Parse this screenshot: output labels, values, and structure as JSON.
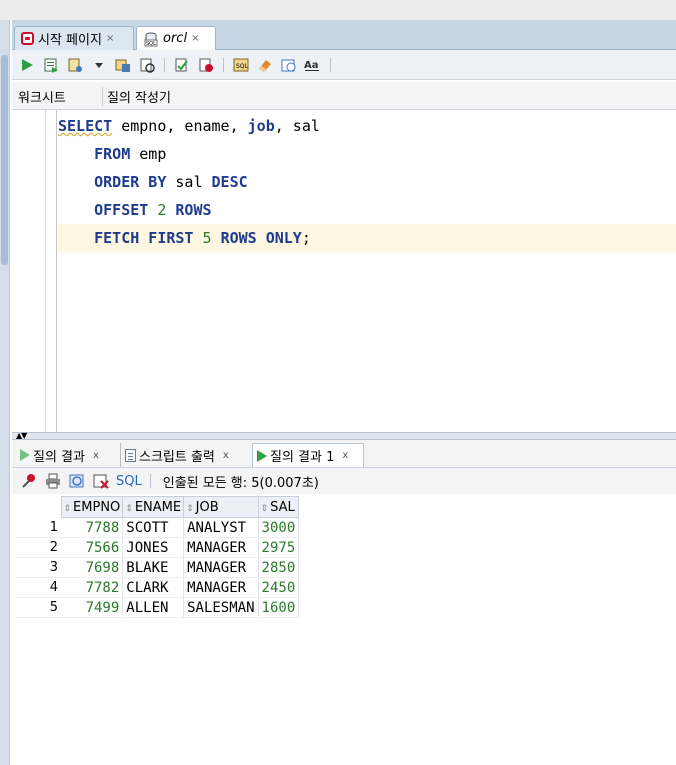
{
  "doc_tabs": [
    {
      "label": "시작 페이지",
      "close": "×"
    },
    {
      "label": "orcl",
      "close": "×"
    }
  ],
  "editor_tabs": [
    "워크시트",
    "질의 작성기"
  ],
  "code_lines": [
    {
      "parts": [
        [
          "kw",
          "SELECT"
        ],
        [
          "t",
          " empno, ename, "
        ],
        [
          "kw",
          "job"
        ],
        [
          "t",
          ", sal"
        ]
      ]
    },
    {
      "parts": [
        [
          "t",
          "    "
        ],
        [
          "kw",
          "FROM"
        ],
        [
          "t",
          " emp"
        ]
      ]
    },
    {
      "parts": [
        [
          "t",
          "    "
        ],
        [
          "kw",
          "ORDER BY"
        ],
        [
          "t",
          " sal "
        ],
        [
          "kw",
          "DESC"
        ]
      ]
    },
    {
      "parts": [
        [
          "t",
          "    "
        ],
        [
          "kw",
          "OFFSET"
        ],
        [
          "t",
          " "
        ],
        [
          "num",
          "2"
        ],
        [
          "t",
          " "
        ],
        [
          "kw",
          "ROWS"
        ]
      ]
    },
    {
      "parts": [
        [
          "t",
          "    "
        ],
        [
          "kw",
          "FETCH FIRST"
        ],
        [
          "t",
          " "
        ],
        [
          "num",
          "5"
        ],
        [
          "t",
          " "
        ],
        [
          "kw",
          "ROWS ONLY"
        ],
        [
          "t",
          ";"
        ]
      ]
    }
  ],
  "result_tabs": [
    {
      "label": "질의 결과",
      "close": "x"
    },
    {
      "label": "스크립트 출력",
      "close": "x"
    },
    {
      "label": "질의 결과 1",
      "close": "x"
    }
  ],
  "result_toolbar": {
    "sql_label": "SQL",
    "status": "인출된 모든 행: 5(0.007초)"
  },
  "grid": {
    "columns": [
      "EMPNO",
      "ENAME",
      "JOB",
      "SAL"
    ],
    "rows": [
      {
        "n": "1",
        "cells": [
          "7788",
          "SCOTT",
          "ANALYST",
          "3000"
        ]
      },
      {
        "n": "2",
        "cells": [
          "7566",
          "JONES",
          "MANAGER",
          "2975"
        ]
      },
      {
        "n": "3",
        "cells": [
          "7698",
          "BLAKE",
          "MANAGER",
          "2850"
        ]
      },
      {
        "n": "4",
        "cells": [
          "7782",
          "CLARK",
          "MANAGER",
          "2450"
        ]
      },
      {
        "n": "5",
        "cells": [
          "7499",
          "ALLEN",
          "SALESMAN",
          "1600"
        ]
      }
    ]
  },
  "colors": {
    "keyword": "#1f3b8f",
    "number": "#2b7a2b",
    "highlight_line": "#fdf6e1",
    "tab_bar": "#c7d6e5"
  }
}
